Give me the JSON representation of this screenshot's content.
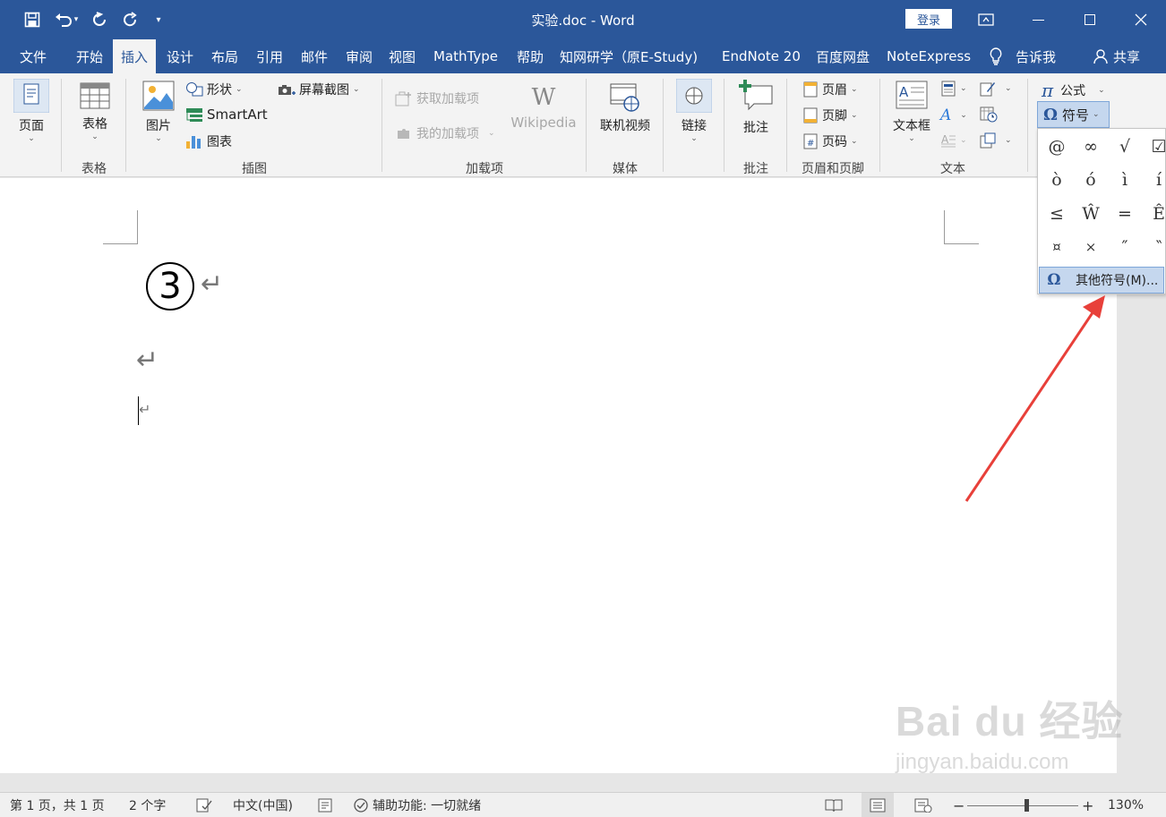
{
  "window": {
    "title": "实验.doc  -  Word",
    "login": "登录",
    "controls": [
      "ribbon-display",
      "minimize",
      "maximize",
      "close"
    ]
  },
  "tabs": [
    {
      "label": "文件"
    },
    {
      "label": "开始"
    },
    {
      "label": "插入",
      "active": true
    },
    {
      "label": "设计"
    },
    {
      "label": "布局"
    },
    {
      "label": "引用"
    },
    {
      "label": "邮件"
    },
    {
      "label": "审阅"
    },
    {
      "label": "视图"
    },
    {
      "label": "MathType"
    },
    {
      "label": "帮助"
    },
    {
      "label": "知网研学（原E-Study)"
    },
    {
      "label": "EndNote 20"
    },
    {
      "label": "百度网盘"
    },
    {
      "label": "NoteExpress"
    },
    {
      "label": "告诉我"
    },
    {
      "label": "共享"
    }
  ],
  "ribbon": {
    "pages": {
      "page": "页面"
    },
    "tables": {
      "table": "表格",
      "group": "表格"
    },
    "illustrations": {
      "picture": "图片",
      "shapes": "形状",
      "smartart": "SmartArt",
      "chart": "图表",
      "screenshot": "屏幕截图",
      "group": "插图"
    },
    "addins": {
      "get_addins": "获取加载项",
      "my_addins": "我的加载项",
      "wikipedia": "Wikipedia",
      "group": "加载项"
    },
    "media": {
      "online_video": "联机视频",
      "group": "媒体"
    },
    "links": {
      "link": "链接"
    },
    "comments": {
      "comment": "批注",
      "group": "批注"
    },
    "header_footer": {
      "header": "页眉",
      "footer": "页脚",
      "page_number": "页码",
      "group": "页眉和页脚"
    },
    "text": {
      "textbox": "文本框",
      "group": "文本"
    },
    "symbols": {
      "equation": "公式",
      "symbol": "符号"
    }
  },
  "symbol_menu": {
    "symbols": [
      "@",
      "∞",
      "√",
      "☑",
      "ò",
      "ó",
      "ì",
      "í",
      "≤",
      "Ŵ",
      "=",
      "Ê",
      "¤",
      "×",
      "″",
      "‶"
    ],
    "more": "其他符号(M)..."
  },
  "document": {
    "circled_number": "③",
    "para_mark": "↵"
  },
  "status": {
    "page": "第 1 页，共 1 页",
    "words": "2 个字",
    "language": "中文(中国)",
    "accessibility": "辅助功能: 一切就绪",
    "zoom_minus": "−",
    "zoom_plus": "+",
    "zoom_level": "130%"
  },
  "watermark": {
    "brand": "Bai du 经验",
    "url": "jingyan.baidu.com"
  },
  "colors": {
    "accent": "#2b579a",
    "arrow": "#e8403a",
    "selected": "#c5d7ee"
  }
}
